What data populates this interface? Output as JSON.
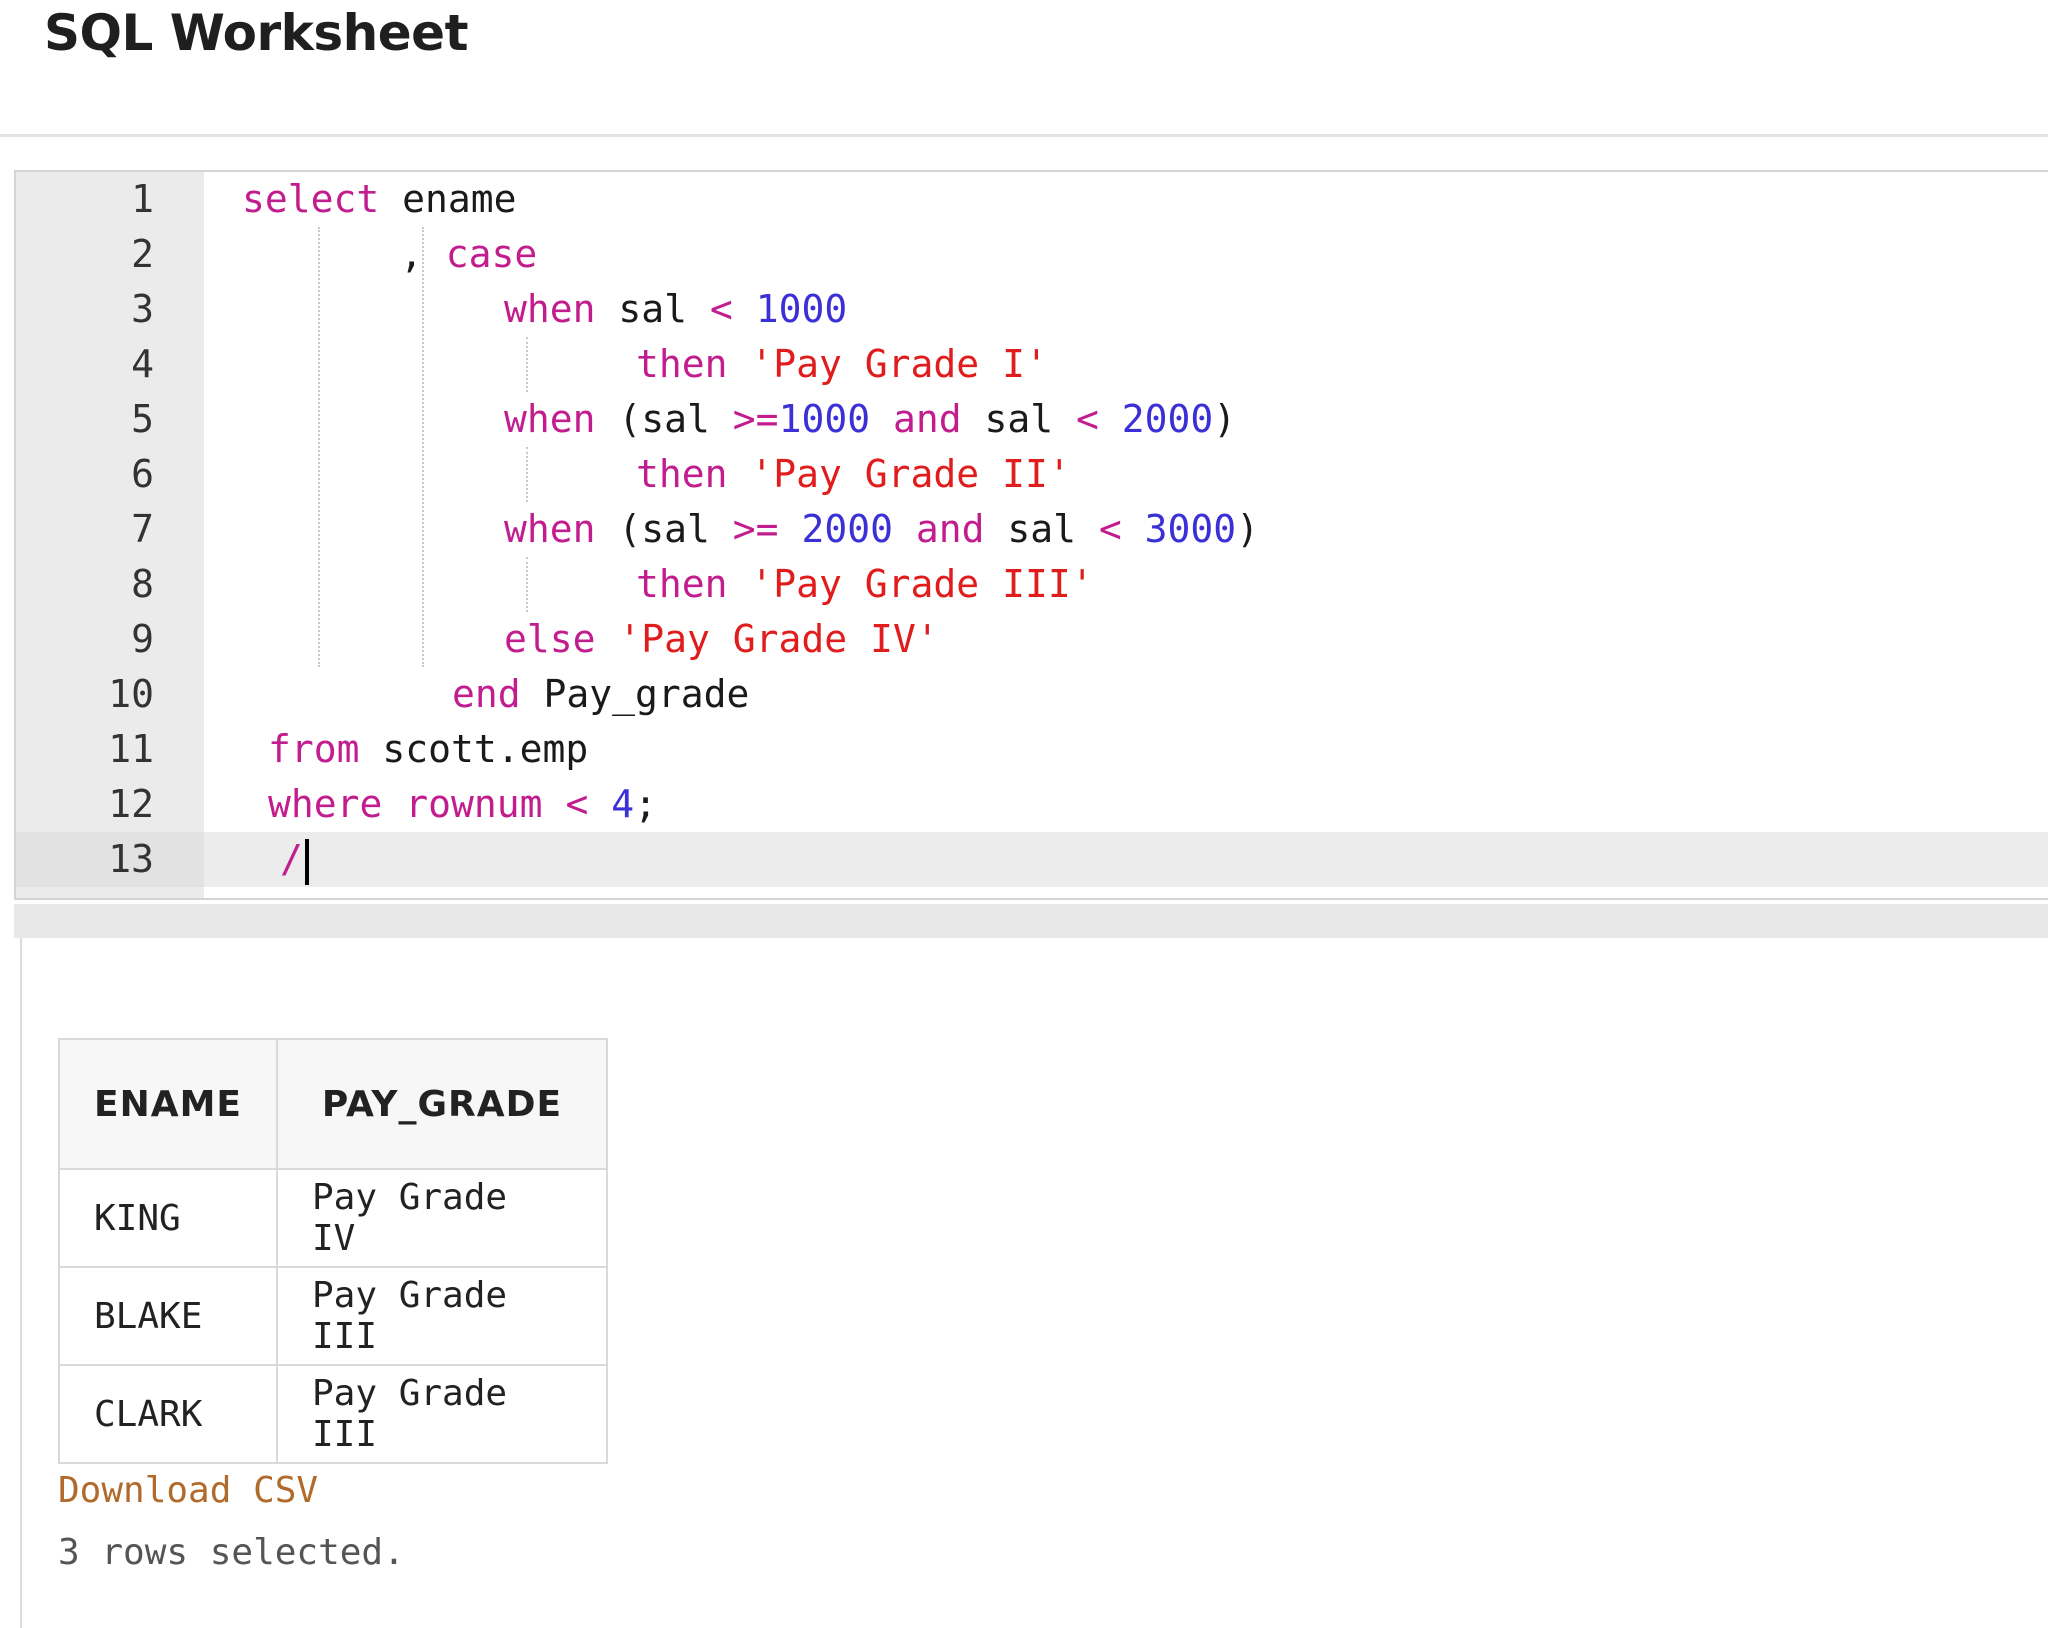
{
  "page": {
    "title": "SQL Worksheet"
  },
  "editor": {
    "line_numbers": [
      "1",
      "2",
      "3",
      "4",
      "5",
      "6",
      "7",
      "8",
      "9",
      "10",
      "11",
      "12",
      "13"
    ],
    "lines": [
      [
        {
          "t": "kw",
          "v": "select"
        },
        {
          "t": "id",
          "v": " ename"
        }
      ],
      [
        {
          "t": "pun",
          "v": ", "
        },
        {
          "t": "kw",
          "v": "case"
        }
      ],
      [
        {
          "t": "kw",
          "v": "when"
        },
        {
          "t": "id",
          "v": " sal "
        },
        {
          "t": "op",
          "v": "<"
        },
        {
          "t": "id",
          "v": " "
        },
        {
          "t": "num",
          "v": "1000"
        }
      ],
      [
        {
          "t": "kw",
          "v": "then"
        },
        {
          "t": "id",
          "v": " "
        },
        {
          "t": "str",
          "v": "'Pay Grade I'"
        }
      ],
      [
        {
          "t": "kw",
          "v": "when"
        },
        {
          "t": "id",
          "v": " (sal "
        },
        {
          "t": "op",
          "v": ">="
        },
        {
          "t": "num",
          "v": "1000"
        },
        {
          "t": "id",
          "v": " "
        },
        {
          "t": "kw",
          "v": "and"
        },
        {
          "t": "id",
          "v": " sal "
        },
        {
          "t": "op",
          "v": "<"
        },
        {
          "t": "id",
          "v": " "
        },
        {
          "t": "num",
          "v": "2000"
        },
        {
          "t": "id",
          "v": ")"
        }
      ],
      [
        {
          "t": "kw",
          "v": "then"
        },
        {
          "t": "id",
          "v": " "
        },
        {
          "t": "str",
          "v": "'Pay Grade II'"
        }
      ],
      [
        {
          "t": "kw",
          "v": "when"
        },
        {
          "t": "id",
          "v": " (sal "
        },
        {
          "t": "op",
          "v": ">="
        },
        {
          "t": "id",
          "v": " "
        },
        {
          "t": "num",
          "v": "2000"
        },
        {
          "t": "id",
          "v": " "
        },
        {
          "t": "kw",
          "v": "and"
        },
        {
          "t": "id",
          "v": " sal "
        },
        {
          "t": "op",
          "v": "<"
        },
        {
          "t": "id",
          "v": " "
        },
        {
          "t": "num",
          "v": "3000"
        },
        {
          "t": "id",
          "v": ")"
        }
      ],
      [
        {
          "t": "kw",
          "v": "then"
        },
        {
          "t": "id",
          "v": " "
        },
        {
          "t": "str",
          "v": "'Pay Grade III'"
        }
      ],
      [
        {
          "t": "kw",
          "v": "else"
        },
        {
          "t": "id",
          "v": " "
        },
        {
          "t": "str",
          "v": "'Pay Grade IV'"
        }
      ],
      [
        {
          "t": "kw",
          "v": "end"
        },
        {
          "t": "id",
          "v": " Pay_grade"
        }
      ],
      [
        {
          "t": "kw",
          "v": "from"
        },
        {
          "t": "id",
          "v": " scott.emp"
        }
      ],
      [
        {
          "t": "kw",
          "v": "where"
        },
        {
          "t": "id",
          "v": " "
        },
        {
          "t": "kw",
          "v": "rownum"
        },
        {
          "t": "id",
          "v": " "
        },
        {
          "t": "op",
          "v": "<"
        },
        {
          "t": "id",
          "v": " "
        },
        {
          "t": "num",
          "v": "4"
        },
        {
          "t": "pun",
          "v": ";"
        }
      ],
      [
        {
          "t": "op",
          "v": "/"
        }
      ]
    ],
    "active_line": "13"
  },
  "results": {
    "columns": [
      "ENAME",
      "PAY_GRADE"
    ],
    "rows": [
      [
        "KING",
        "Pay Grade IV"
      ],
      [
        "BLAKE",
        "Pay Grade III"
      ],
      [
        "CLARK",
        "Pay Grade III"
      ]
    ],
    "download_label": "Download CSV",
    "row_count_text": "3 rows selected."
  },
  "colors": {
    "keyword": "#c21d8f",
    "number": "#3b2fd6",
    "string": "#e01c1c",
    "link": "#b06a2b"
  }
}
